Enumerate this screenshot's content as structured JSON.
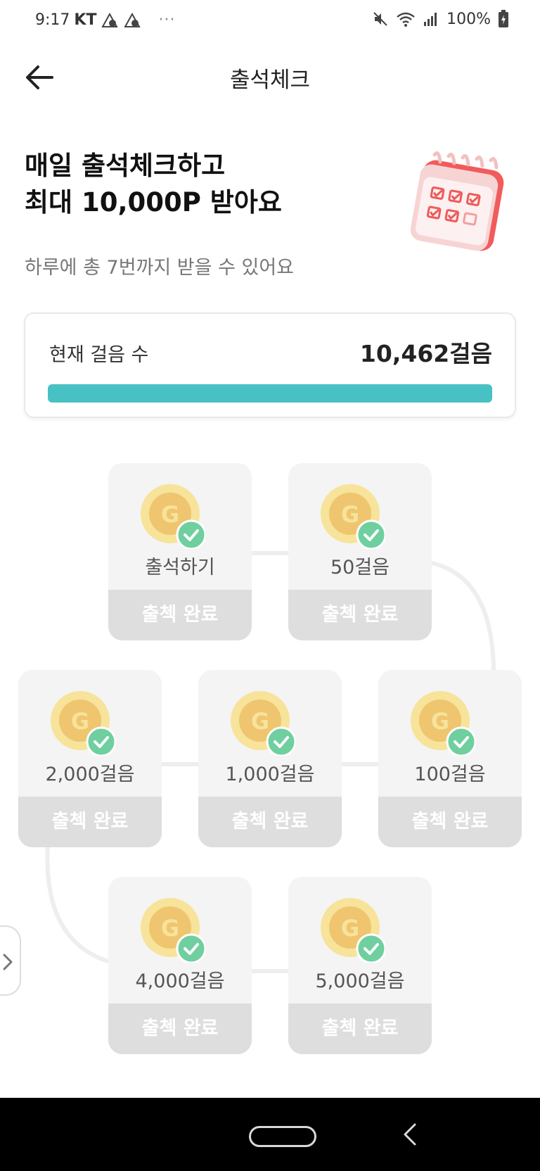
{
  "status_bar": {
    "time": "9:17",
    "carrier": "KT",
    "dots": "···",
    "battery": "100%"
  },
  "header": {
    "title": "출석체크",
    "back_icon": "arrow-left-icon"
  },
  "hero": {
    "title": "매일 출석체크하고\n최대 10,000P 받아요",
    "subtitle": "하루에 총 7번까지 받을 수 있어요"
  },
  "steps": {
    "label": "현재 걸음 수",
    "value": "10,462걸음",
    "progress": 1.0,
    "accent_color": "#47c1c4"
  },
  "rewards": [
    {
      "label": "출석하기",
      "status": "출첵 완료"
    },
    {
      "label": "50걸음",
      "status": "출첵 완료"
    },
    {
      "label": "100걸음",
      "status": "출첵 완료"
    },
    {
      "label": "1,000걸음",
      "status": "출첵 완료"
    },
    {
      "label": "2,000걸음",
      "status": "출첵 완료"
    },
    {
      "label": "4,000걸음",
      "status": "출첵 완료"
    },
    {
      "label": "5,000걸음",
      "status": "출첵 완료"
    }
  ],
  "coin": {
    "letter": "G",
    "icon": "coin-icon",
    "check_icon": "check-icon"
  }
}
